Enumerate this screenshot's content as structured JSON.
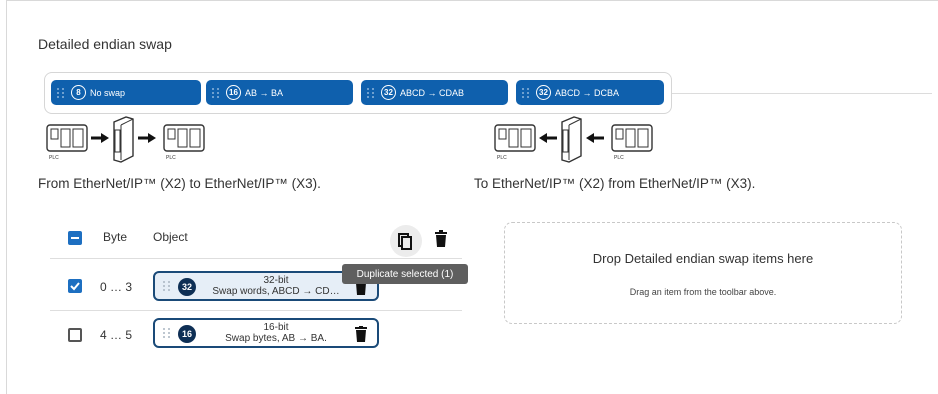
{
  "title": "Detailed endian swap",
  "toolbar": {
    "chips": [
      {
        "badge": "8",
        "label": "No swap"
      },
      {
        "badge": "16",
        "label": "AB → BA"
      },
      {
        "badge": "32",
        "label": "ABCD → CDAB"
      },
      {
        "badge": "32",
        "label": "ABCD → DCBA"
      }
    ]
  },
  "diagram": {
    "plc_label": "PLC"
  },
  "captions": {
    "left": "From EtherNet/IP™ (X2) to EtherNet/IP™ (X3).",
    "right": "To EtherNet/IP™ (X2) from EtherNet/IP™ (X3)."
  },
  "table": {
    "col_byte": "Byte",
    "col_object": "Object",
    "rows": [
      {
        "checked": true,
        "byte": "0 … 3",
        "badge": "32",
        "line1": "32-bit",
        "line2": "Swap words, ABCD → CD…"
      },
      {
        "checked": false,
        "byte": "4 … 5",
        "badge": "16",
        "line1": "16-bit",
        "line2": "Swap bytes, AB → BA."
      }
    ]
  },
  "tooltip": "Duplicate selected (1)",
  "dropzone": {
    "title": "Drop Detailed endian swap items here",
    "subtitle": "Drag an item from the toolbar above."
  },
  "colors": {
    "accent": "#0f60ad",
    "dark_badge": "#0e2f55",
    "checkbox": "#1d6fc1"
  }
}
